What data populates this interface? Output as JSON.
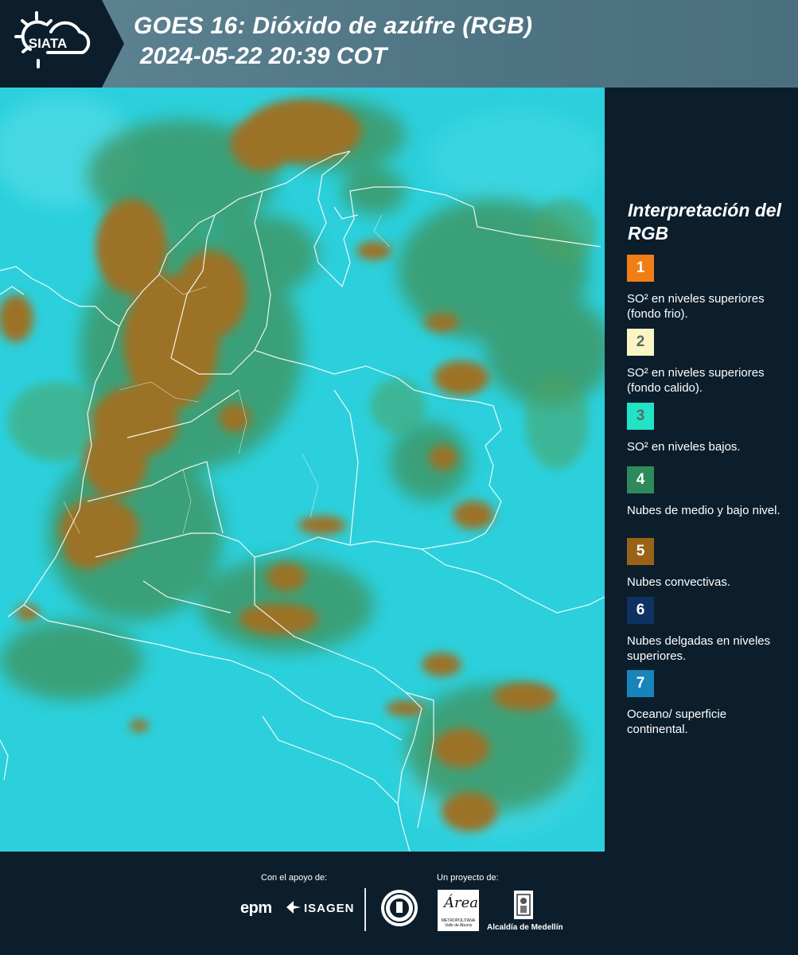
{
  "header": {
    "logo_text": "SIATA",
    "title": "GOES 16: Dióxido de azúfre (RGB)",
    "subtitle": "2024-05-22 20:39 COT"
  },
  "legend": {
    "title": "Interpretación del RGB",
    "items": [
      {
        "number": "1",
        "color": "#f07e14",
        "text": "SO² en niveles superiores (fondo frio)."
      },
      {
        "number": "2",
        "color": "#fbf5c3",
        "text": "SO² en niveles superiores (fondo calido)."
      },
      {
        "number": "3",
        "color": "#21e4c4",
        "text": "SO² en niveles bajos."
      },
      {
        "number": "4",
        "color": "#2e8a5a",
        "text": "Nubes de medio y bajo nivel."
      },
      {
        "number": "5",
        "color": "#9a6216",
        "text": "Nubes convectivas."
      },
      {
        "number": "6",
        "color": "#0f3263",
        "text": "Nubes delgadas en niveles superiores."
      },
      {
        "number": "7",
        "color": "#1785ba",
        "text": "Oceano/ superficie continental."
      }
    ]
  },
  "footer": {
    "support_label": "Con el apoyo de:",
    "project_label": "Un proyecto de:",
    "sponsor_1": "epm",
    "sponsor_2": "ISAGEN",
    "partner_1": "Área",
    "partner_1_sub": "METROPOLITANA Valle de Aburrá",
    "partner_2": "Alcaldía de Medellín"
  },
  "map_colors": {
    "ocean": "#2bd3df",
    "convective": "#9b7228",
    "midlevel": "#3b8f56",
    "borders": "#ffffff"
  }
}
